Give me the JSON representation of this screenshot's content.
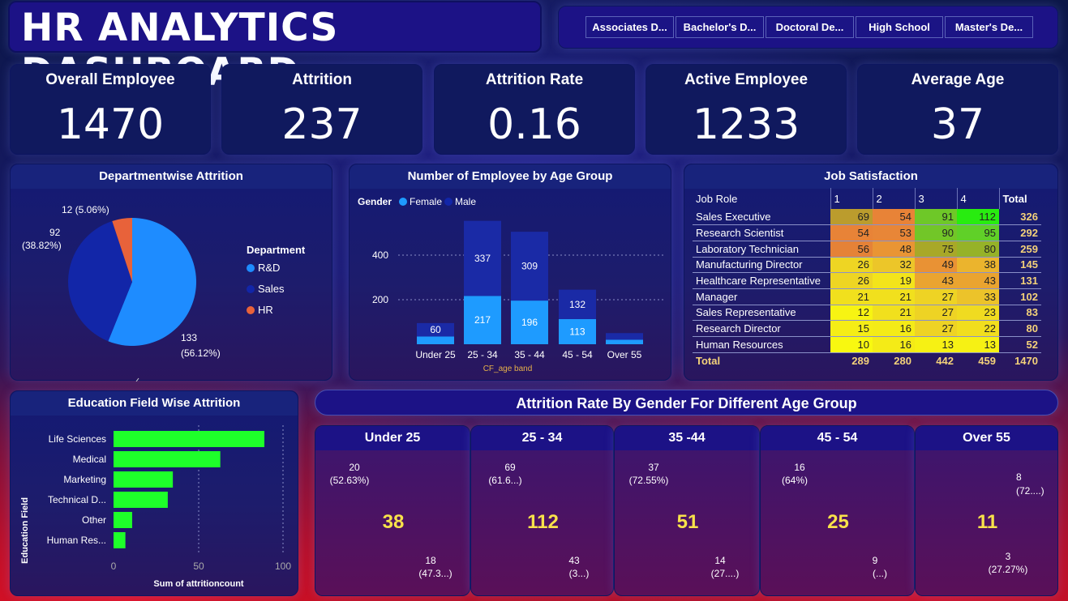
{
  "title": "HR ANALYTICS DASHBOARD",
  "education_slicer": [
    "Associates D...",
    "Bachelor's D...",
    "Doctoral De...",
    "High School",
    "Master's De..."
  ],
  "kpis": [
    {
      "label": "Overall Employee",
      "value": "1470"
    },
    {
      "label": "Attrition",
      "value": "237"
    },
    {
      "label": "Attrition Rate",
      "value": "0.16"
    },
    {
      "label": "Active Employee",
      "value": "1233"
    },
    {
      "label": "Average Age",
      "value": "37"
    }
  ],
  "dept": {
    "title": "Departmentwise Attrition",
    "legend_title": "Department",
    "legend": [
      "R&D",
      "Sales",
      "HR"
    ],
    "labels": {
      "rd_v": "133",
      "rd_p": "(56.12%)",
      "sales_v": "92",
      "sales_p": "(38.82%)",
      "hr": "12 (5.06%)"
    },
    "colors": {
      "rd": "#1e8cff",
      "sales": "#1226a8",
      "hr": "#e8623a"
    }
  },
  "age": {
    "title": "Number of Employee by Age Group",
    "legend_title": "Gender",
    "legend_female": "Female",
    "legend_male": "Male",
    "x_label": "CF_age band",
    "y_ticks": [
      "400",
      "200"
    ]
  },
  "job": {
    "title": "Job Satisfaction",
    "header": [
      "Job Role",
      "1",
      "2",
      "3",
      "4",
      "Total"
    ],
    "rows": [
      [
        "Sales Executive",
        "69",
        "54",
        "91",
        "112",
        "326"
      ],
      [
        "Research Scientist",
        "54",
        "53",
        "90",
        "95",
        "292"
      ],
      [
        "Laboratory Technician",
        "56",
        "48",
        "75",
        "80",
        "259"
      ],
      [
        "Manufacturing Director",
        "26",
        "32",
        "49",
        "38",
        "145"
      ],
      [
        "Healthcare Representative",
        "26",
        "19",
        "43",
        "43",
        "131"
      ],
      [
        "Manager",
        "21",
        "21",
        "27",
        "33",
        "102"
      ],
      [
        "Sales Representative",
        "12",
        "21",
        "27",
        "23",
        "83"
      ],
      [
        "Research Director",
        "15",
        "16",
        "27",
        "22",
        "80"
      ],
      [
        "Human Resources",
        "10",
        "16",
        "13",
        "13",
        "52"
      ]
    ],
    "total": [
      "Total",
      "289",
      "280",
      "442",
      "459",
      "1470"
    ]
  },
  "edu": {
    "title": "Education Field Wise Attrition",
    "y_label": "Education Field",
    "x_label": "Sum of attritioncount",
    "x_ticks": [
      "0",
      "50",
      "100"
    ]
  },
  "gender_title": "Attrition Rate By Gender For Different Age Group",
  "gauges": [
    {
      "title": "Under 25",
      "center": "38",
      "l1": "20",
      "l2": "(52.63%)",
      "r1": "18",
      "r2": "(47.3...)"
    },
    {
      "title": "25 - 34",
      "center": "112",
      "l1": "69",
      "l2": "(61.6...)",
      "r1": "43",
      "r2": "(3...)"
    },
    {
      "title": "35 -44",
      "center": "51",
      "l1": "37",
      "l2": "(72.55%)",
      "r1": "14",
      "r2": "(27....)"
    },
    {
      "title": "45 - 54",
      "center": "25",
      "l1": "16",
      "l2": "(64%)",
      "r1": "9",
      "r2": "(...)"
    },
    {
      "title": "Over 55",
      "center": "11",
      "l1": "8",
      "l2": "(72....)",
      "r1": "3",
      "r2": "(27.27%)"
    }
  ],
  "chart_data": [
    {
      "type": "pie",
      "title": "Departmentwise Attrition",
      "categories": [
        "R&D",
        "Sales",
        "HR"
      ],
      "values": [
        133,
        92,
        12
      ],
      "percent": [
        56.12,
        38.82,
        5.06
      ]
    },
    {
      "type": "bar",
      "stacked": true,
      "title": "Number of Employee by Age Group",
      "xlabel": "CF_age band",
      "categories": [
        "Under 25",
        "25 - 34",
        "35 - 44",
        "45 - 54",
        "Over 55"
      ],
      "series": [
        {
          "name": "Female",
          "values": [
            35,
            217,
            196,
            113,
            20
          ]
        },
        {
          "name": "Male",
          "values": [
            60,
            337,
            309,
            132,
            30
          ]
        }
      ],
      "ylim": [
        0,
        500
      ]
    },
    {
      "type": "bar",
      "orientation": "horizontal",
      "title": "Education Field Wise Attrition",
      "xlabel": "Sum of attritioncount",
      "ylabel": "Education Field",
      "categories": [
        "Life Sciences",
        "Medical",
        "Marketing",
        "Technical D...",
        "Other",
        "Human Res..."
      ],
      "values": [
        89,
        63,
        35,
        32,
        11,
        7
      ],
      "xlim": [
        0,
        100
      ]
    },
    {
      "type": "pie",
      "donut": true,
      "title": "Under 25",
      "values": [
        20,
        18
      ]
    },
    {
      "type": "pie",
      "donut": true,
      "title": "25 - 34",
      "values": [
        69,
        43
      ]
    },
    {
      "type": "pie",
      "donut": true,
      "title": "35 -44",
      "values": [
        37,
        14
      ]
    },
    {
      "type": "pie",
      "donut": true,
      "title": "45 - 54",
      "values": [
        16,
        9
      ]
    },
    {
      "type": "pie",
      "donut": true,
      "title": "Over 55",
      "values": [
        8,
        3
      ]
    }
  ]
}
